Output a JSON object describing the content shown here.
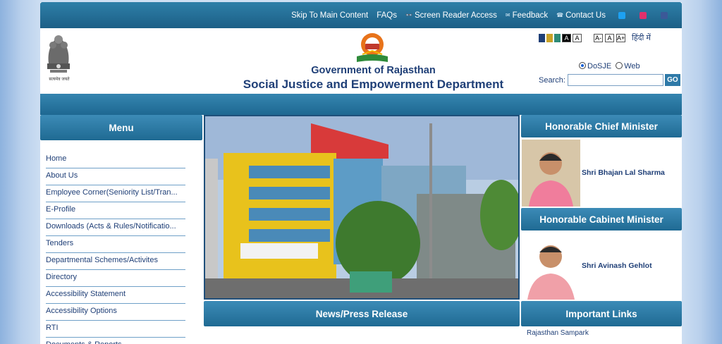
{
  "topbar": {
    "links": [
      {
        "label": "Skip To Main Content",
        "icon": ""
      },
      {
        "label": "FAQs",
        "icon": ""
      },
      {
        "label": "Screen Reader Access",
        "icon": "glasses-icon"
      },
      {
        "label": "Feedback",
        "icon": "envelope-icon"
      },
      {
        "label": "Contact Us",
        "icon": "phone-icon"
      }
    ],
    "social": [
      {
        "name": "twitter-icon",
        "color": "#1da1f2"
      },
      {
        "name": "instagram-icon",
        "color": "#e1306c"
      },
      {
        "name": "facebook-icon",
        "color": "#3b5998"
      }
    ]
  },
  "header": {
    "emblem_caption": "सत्यमेव जयते",
    "government": "Government of Rajasthan",
    "department": "Social Justice and Empowerment Department",
    "contrast_colors": [
      "#1f3f77",
      "#c9a227",
      "#2e8b78",
      "#000000"
    ],
    "contrast_labels": [
      "A",
      "A"
    ],
    "font_sizes": [
      "A-",
      "A",
      "A+"
    ],
    "language": "हिंदी में",
    "search_scope": [
      {
        "label": "DoSJE",
        "selected": true
      },
      {
        "label": "Web",
        "selected": false
      }
    ],
    "search_label": "Search:",
    "search_button": "GO"
  },
  "menu": {
    "title": "Menu",
    "items": [
      "Home",
      "About Us",
      "Employee Corner(Seniority List/Tran...",
      "E-Profile",
      "Downloads (Acts & Rules/Notificatio...",
      "Tenders",
      "Departmental Schemes/Activites",
      "Directory",
      "Accessibility Statement",
      "Accessibility Options",
      "RTI",
      "Documents & Reports"
    ]
  },
  "center": {
    "news_title": "News/Press Release"
  },
  "right": {
    "cm_title": "Honorable Chief Minister",
    "cm_name": "Shri Bhajan Lal Sharma",
    "minister_title": "Honorable Cabinet Minister",
    "minister_name": "Shri Avinash Gehlot",
    "links_title": "Important Links",
    "first_link": "Rajasthan Sampark"
  }
}
